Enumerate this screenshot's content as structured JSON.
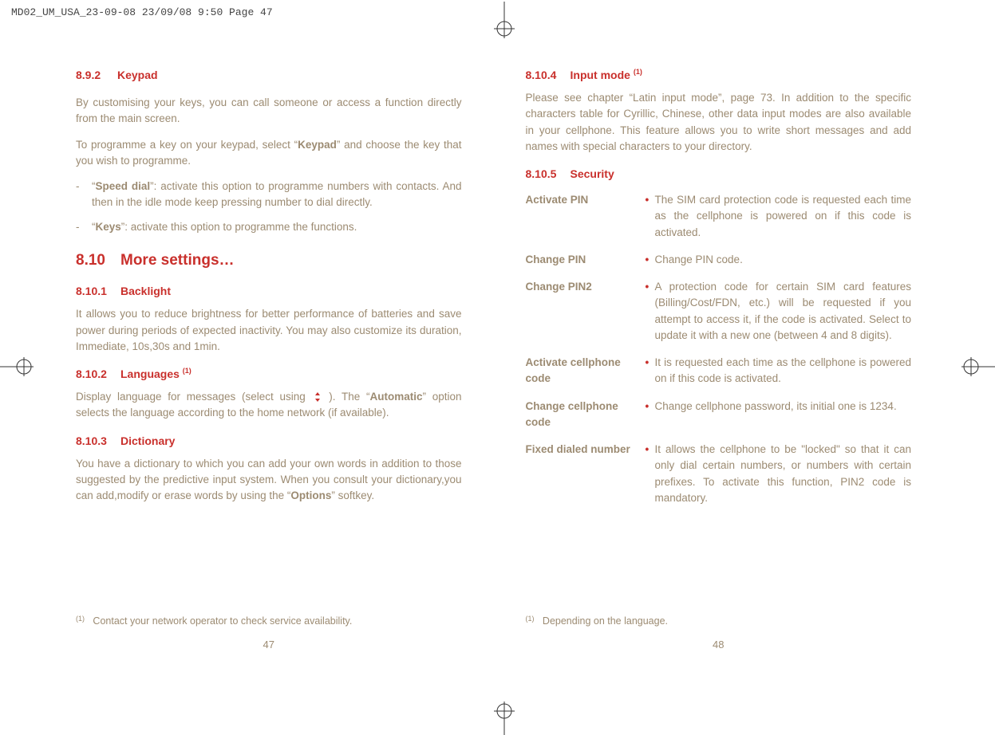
{
  "slug": "MD02_UM_USA_23-09-08  23/09/08  9:50  Page 47",
  "left": {
    "s892_num": "8.9.2",
    "s892_title": "Keypad",
    "p1": "By customising your keys, you can call someone or access a function directly from the main screen.",
    "p2a": "To programme a key on your keypad, select “",
    "p2b": "Keypad",
    "p2c": "” and choose the key that you wish to programme.",
    "li1_lead": "“",
    "li1_bold": "Speed dial",
    "li1_rest": "”: activate this option to programme numbers with contacts. And then in the idle mode keep pressing number to dial directly.",
    "li2_lead": "“",
    "li2_bold": "Keys",
    "li2_rest": "”: activate this option to programme the functions.",
    "s810_num": "8.10",
    "s810_title": "More settings…",
    "s8101_num": "8.10.1",
    "s8101_title": "Backlight",
    "p3": "It allows you to reduce brightness for better performance of batteries and save power during periods of expected inactivity. You may also customize its duration, Immediate, 10s,30s and 1min.",
    "s8102_num": "8.10.2",
    "s8102_title": "Languages ",
    "s8102_fn": "(1)",
    "p4a": "Display language for messages (select using ",
    "p4b": " ). The “",
    "p4c": "Automatic",
    "p4d": "” option selects the language according to the home network (if available).",
    "s8103_num": "8.10.3",
    "s8103_title": "Dictionary",
    "p5a": "You have a dictionary to which you can add your own words in addition to those suggested by the predictive input system. When you consult your dictionary,you can add,modify or erase words by using the “",
    "p5b": "Options",
    "p5c": "” softkey.",
    "footnote_sup": "(1)",
    "footnote": "Contact your network operator to check service availability.",
    "pagenum": "47"
  },
  "right": {
    "s8104_num": "8.10.4",
    "s8104_title": "Input mode ",
    "s8104_fn": "(1)",
    "p1": "Please see chapter “Latin input mode”, page 73. In addition to the specific characters table for Cyrillic, Chinese, other data input modes are also available in your cellphone. This feature allows you to write short messages and add names with special characters to your directory.",
    "s8105_num": "8.10.5",
    "s8105_title": "Security",
    "rows": {
      "r1_label": "Activate PIN",
      "r1_text": "The SIM card protection code is requested each time as the cellphone is powered on if this code is activated.",
      "r2_label": "Change PIN",
      "r2_text": "Change PIN code.",
      "r3_label": "Change PIN2",
      "r3_text": "A protection code for certain SIM card features (Billing/Cost/FDN, etc.) will be requested if you attempt to access it, if the code is activated. Select to update it with a new one (between 4 and 8 digits).",
      "r4_label": "Activate cellphone code",
      "r4_text": "It is requested each time as the cellphone is powered on if this code is activated.",
      "r5_label": "Change cellphone code",
      "r5_text": "Change cellphone password, its initial one is 1234.",
      "r6_label": "Fixed dialed number",
      "r6_text": "It allows the cellphone to be \"locked\" so that it can only dial certain numbers, or numbers with certain prefixes. To activate this function, PIN2 code is mandatory."
    },
    "footnote_sup": "(1)",
    "footnote": "Depending on the language.",
    "pagenum": "48"
  }
}
